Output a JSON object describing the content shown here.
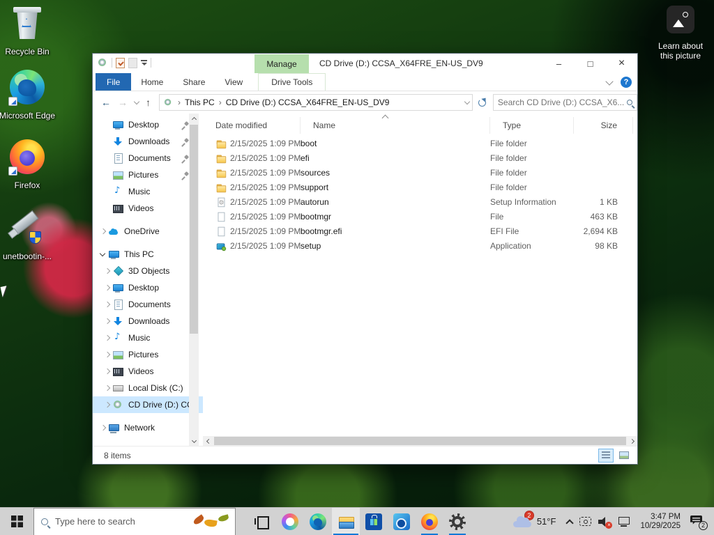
{
  "colors": {
    "accent": "#0078d7",
    "selection": "#cce8ff",
    "manage_tab_green": "#b6dfad",
    "file_tab_blue": "#2268b2"
  },
  "desktop": {
    "icons": [
      {
        "label": "Recycle Bin",
        "icon": "recycle-bin"
      },
      {
        "label": "Microsoft Edge",
        "icon": "edge"
      },
      {
        "label": "Firefox",
        "icon": "firefox"
      },
      {
        "label": "unetbootin-...",
        "icon": "unetbootin"
      }
    ],
    "learn_about_label": "Learn about this picture"
  },
  "window": {
    "title": "CD Drive (D:) CCSA_X64FRE_EN-US_DV9",
    "contextual_tab": "Manage",
    "ribbon_tabs": [
      "File",
      "Home",
      "Share",
      "View",
      "Drive Tools"
    ],
    "controls": {
      "minimize": "–",
      "maximize": "□",
      "close": "×"
    },
    "help_label": "?",
    "breadcrumb": [
      "This PC",
      "CD Drive (D:) CCSA_X64FRE_EN-US_DV9"
    ],
    "search_placeholder": "Search CD Drive (D:) CCSA_X6...",
    "status_items": "8 items"
  },
  "sidebar": {
    "items": [
      {
        "label": "Desktop",
        "icon": "monitor",
        "level": 2,
        "pinned": true
      },
      {
        "label": "Downloads",
        "icon": "download",
        "level": 2,
        "pinned": true
      },
      {
        "label": "Documents",
        "icon": "doc",
        "level": 2,
        "pinned": true
      },
      {
        "label": "Pictures",
        "icon": "pic",
        "level": 2,
        "pinned": true
      },
      {
        "label": "Music",
        "icon": "music",
        "level": 2
      },
      {
        "label": "Videos",
        "icon": "video",
        "level": 2
      },
      {
        "label": "OneDrive",
        "icon": "cloud",
        "level": 1,
        "expander": "right",
        "gap": true
      },
      {
        "label": "This PC",
        "icon": "monitor",
        "level": 1,
        "expander": "down",
        "gap": true
      },
      {
        "label": "3D Objects",
        "icon": "cube",
        "level": 2,
        "expander": "right"
      },
      {
        "label": "Desktop",
        "icon": "monitor",
        "level": 2,
        "expander": "right"
      },
      {
        "label": "Documents",
        "icon": "doc",
        "level": 2,
        "expander": "right"
      },
      {
        "label": "Downloads",
        "icon": "download",
        "level": 2,
        "expander": "right"
      },
      {
        "label": "Music",
        "icon": "music",
        "level": 2,
        "expander": "right"
      },
      {
        "label": "Pictures",
        "icon": "pic",
        "level": 2,
        "expander": "right"
      },
      {
        "label": "Videos",
        "icon": "video",
        "level": 2,
        "expander": "right"
      },
      {
        "label": "Local Disk (C:)",
        "icon": "disk",
        "level": 2,
        "expander": "right"
      },
      {
        "label": "CD Drive (D:) CC",
        "icon": "disc",
        "level": 2,
        "expander": "right",
        "selected": true
      },
      {
        "label": "Network",
        "icon": "network",
        "level": 1,
        "expander": "right",
        "gap": true
      }
    ]
  },
  "filelist": {
    "columns": [
      "Date modified",
      "Name",
      "Type",
      "Size"
    ],
    "sort_column": "Name",
    "rows": [
      {
        "icon": "folder",
        "date": "2/15/2025 1:09 PM",
        "name": "boot",
        "type": "File folder",
        "size": ""
      },
      {
        "icon": "folder",
        "date": "2/15/2025 1:09 PM",
        "name": "efi",
        "type": "File folder",
        "size": ""
      },
      {
        "icon": "folder",
        "date": "2/15/2025 1:09 PM",
        "name": "sources",
        "type": "File folder",
        "size": ""
      },
      {
        "icon": "folder",
        "date": "2/15/2025 1:09 PM",
        "name": "support",
        "type": "File folder",
        "size": ""
      },
      {
        "icon": "setupinfo",
        "date": "2/15/2025 1:09 PM",
        "name": "autorun",
        "type": "Setup Information",
        "size": "1 KB"
      },
      {
        "icon": "file",
        "date": "2/15/2025 1:09 PM",
        "name": "bootmgr",
        "type": "File",
        "size": "463 KB"
      },
      {
        "icon": "file",
        "date": "2/15/2025 1:09 PM",
        "name": "bootmgr.efi",
        "type": "EFI File",
        "size": "2,694 KB"
      },
      {
        "icon": "setup",
        "date": "2/15/2025 1:09 PM",
        "name": "setup",
        "type": "Application",
        "size": "98 KB"
      }
    ]
  },
  "taskbar": {
    "search_placeholder": "Type here to search",
    "apps": [
      {
        "name": "task-view"
      },
      {
        "name": "copilot"
      },
      {
        "name": "edge"
      },
      {
        "name": "file-explorer",
        "active": true
      },
      {
        "name": "store"
      },
      {
        "name": "outlook"
      },
      {
        "name": "firefox",
        "running": true
      },
      {
        "name": "settings",
        "running": true
      }
    ],
    "weather_temp": "51°F",
    "weather_badge": "2",
    "speaker_muted_badge": "×",
    "clock_time": "3:47 PM",
    "clock_date": "10/29/2025",
    "notification_badge": "2"
  }
}
